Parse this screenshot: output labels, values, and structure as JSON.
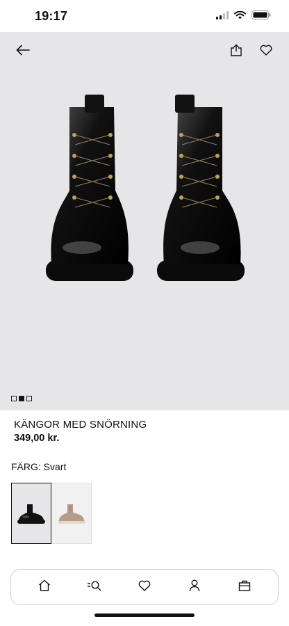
{
  "status": {
    "time": "19:17"
  },
  "product": {
    "title": "KÄNGOR MED SNÖRNING",
    "price": "349,00 kr.",
    "color_label": "FÄRG: Svart"
  },
  "gallery": {
    "pages": 3,
    "active_index": 1
  },
  "swatches": [
    {
      "color": "#111111",
      "selected": true
    },
    {
      "color": "#b59b8a",
      "selected": false
    }
  ],
  "nav": {
    "items": [
      "home-icon",
      "search-icon",
      "heart-icon",
      "person-icon",
      "bag-icon"
    ]
  },
  "colors": {
    "hero_bg": "#e6e6e8",
    "text": "#111111"
  }
}
